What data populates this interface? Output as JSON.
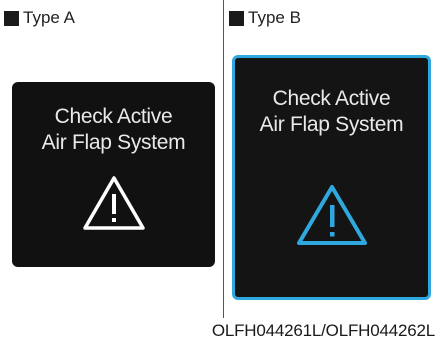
{
  "type_a": {
    "label": "Type A",
    "message_line1": "Check Active",
    "message_line2": "Air Flap System",
    "warning_icon": "warning-triangle-icon",
    "icon_color": "#ffffff"
  },
  "type_b": {
    "label": "Type B",
    "message_line1": "Check Active",
    "message_line2": "Air Flap System",
    "warning_icon": "warning-triangle-icon",
    "icon_color": "#2fa8df",
    "frame_color": "#2fa8df"
  },
  "caption": "OLFH044261L/OLFH044262L"
}
